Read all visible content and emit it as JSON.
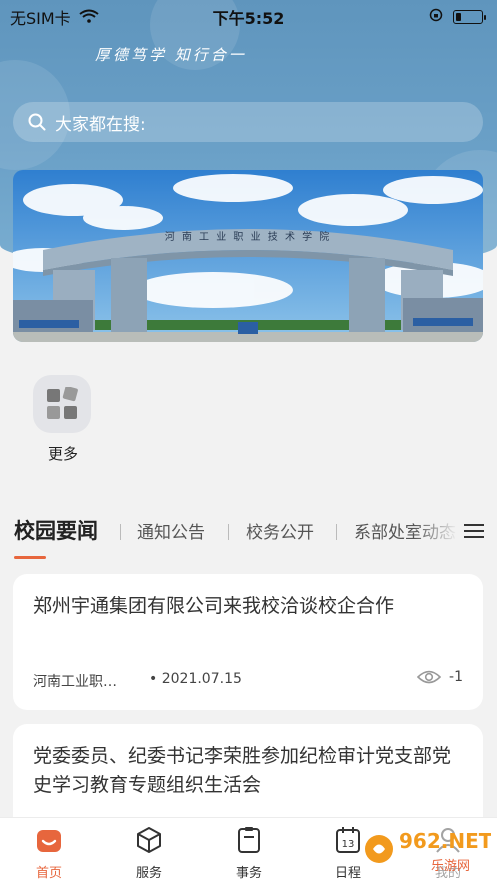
{
  "status_bar": {
    "carrier": "无SIM卡",
    "time": "下午5:52"
  },
  "header": {
    "slogan": "厚德笃学  知行合一"
  },
  "search": {
    "placeholder": "大家都在搜:"
  },
  "banner": {
    "gate_text": "河 南 工 业 职 业 技 术 学 院"
  },
  "quick_entries": [
    {
      "label": "更多",
      "icon": "grid-more-icon"
    }
  ],
  "news_tabs": [
    {
      "label": "校园要闻",
      "active": true
    },
    {
      "label": "通知公告",
      "active": false
    },
    {
      "label": "校务公开",
      "active": false
    },
    {
      "label": "系部处室动态",
      "active": false
    }
  ],
  "news": [
    {
      "title": "郑州宇通集团有限公司来我校洽谈校企合作",
      "source": "河南工业职…",
      "date": "2021.07.15",
      "views": "-1"
    },
    {
      "title": "党委委员、纪委书记李荣胜参加纪检审计党支部党史学习教育专题组织生活会"
    }
  ],
  "tabbar": [
    {
      "label": "首页",
      "icon": "home-icon",
      "active": true
    },
    {
      "label": "服务",
      "icon": "cube-icon",
      "active": false
    },
    {
      "label": "事务",
      "icon": "clipboard-icon",
      "active": false
    },
    {
      "label": "日程",
      "icon": "calendar-icon",
      "active": false
    },
    {
      "label": "我的",
      "icon": "user-icon",
      "active": false
    }
  ],
  "watermark": {
    "brand": "962.NET",
    "sub": "乐游网"
  },
  "colors": {
    "accent": "#e7663d",
    "header": "#6aa0c7"
  }
}
